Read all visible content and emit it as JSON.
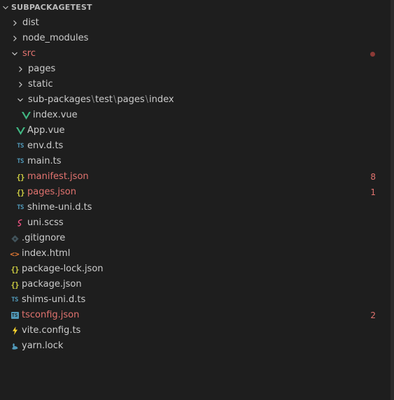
{
  "explorer": {
    "root_label": "SUBPACKAGETEST",
    "items": {
      "dist": "dist",
      "node_modules": "node_modules",
      "src": "src",
      "pages": "pages",
      "static": "static",
      "sub_path": [
        "sub-packages",
        "test",
        "pages",
        "index"
      ],
      "index_vue": "index.vue",
      "app_vue": "App.vue",
      "env_d_ts": "env.d.ts",
      "main_ts": "main.ts",
      "manifest_json": "manifest.json",
      "manifest_badge": "8",
      "pages_json": "pages.json",
      "pages_badge": "1",
      "shime_uni_d_ts": "shime-uni.d.ts",
      "uni_scss": "uni.scss",
      "gitignore": ".gitignore",
      "index_html": "index.html",
      "package_lock_json": "package-lock.json",
      "package_json": "package.json",
      "shims_uni_d_ts": "shims-uni.d.ts",
      "tsconfig_json": "tsconfig.json",
      "tsconfig_badge": "2",
      "vite_config_ts": "vite.config.ts",
      "yarn_lock": "yarn.lock"
    },
    "icons": {
      "ts": "TS",
      "json": "{}",
      "html": "<>"
    },
    "colors": {
      "background": "#1e1e1e",
      "text": "#cccccc",
      "modified": "#e2736f",
      "ts": "#519aba",
      "json": "#cbcb41",
      "vue": "#41b883",
      "html": "#e37933"
    }
  }
}
